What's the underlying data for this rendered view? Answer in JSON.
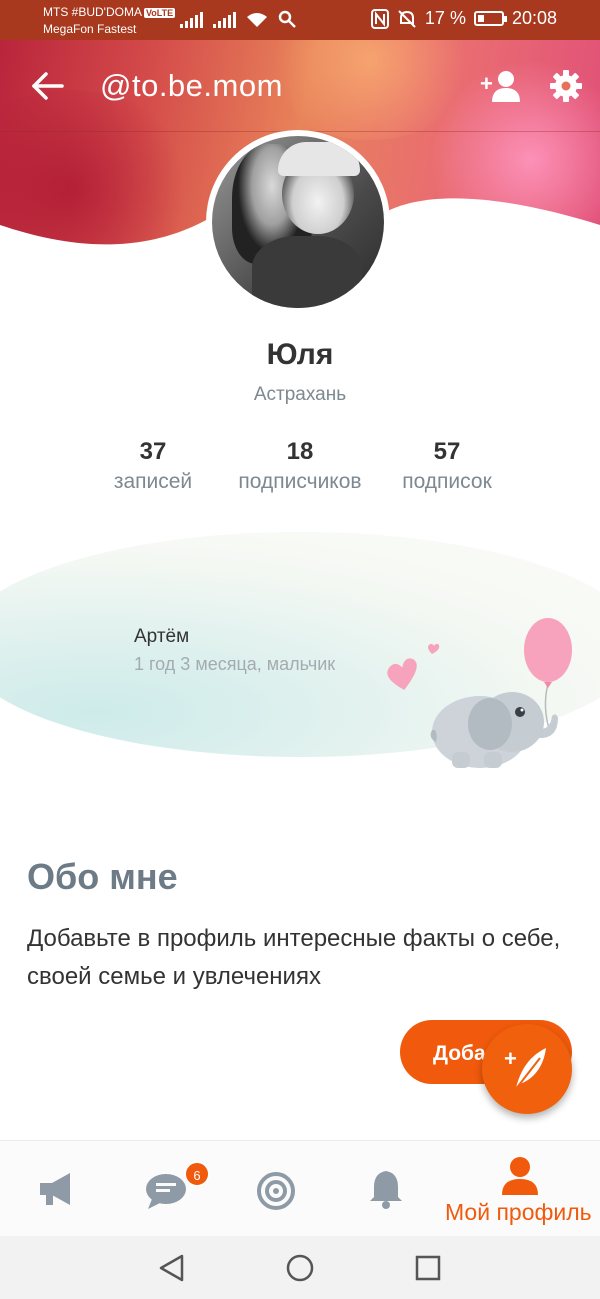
{
  "status_bar": {
    "carrier_line1": "MTS #BUD'DOMA",
    "volte": "VoLTE",
    "carrier_line2": "MegaFon Fastest",
    "battery": "17 %",
    "time": "20:08"
  },
  "toolbar": {
    "handle": "@to.be.mom"
  },
  "profile": {
    "name": "Юля",
    "city": "Астрахань",
    "stats": [
      {
        "value": "37",
        "label": "записей"
      },
      {
        "value": "18",
        "label": "подписчиков"
      },
      {
        "value": "57",
        "label": "подписок"
      }
    ]
  },
  "child": {
    "name": "Артём",
    "info": "1 год 3 месяца, мальчик"
  },
  "about": {
    "title": "Обо мне",
    "text": "Добавьте в профиль интересные факты о себе, своей семье и увлечениях",
    "add_button": "Добавить"
  },
  "bottom_nav": {
    "messages_badge": "6",
    "profile_label": "Мой профиль"
  },
  "colors": {
    "accent": "#f15a0c",
    "muted": "#7d8891",
    "status_bar": "#a8391f"
  }
}
